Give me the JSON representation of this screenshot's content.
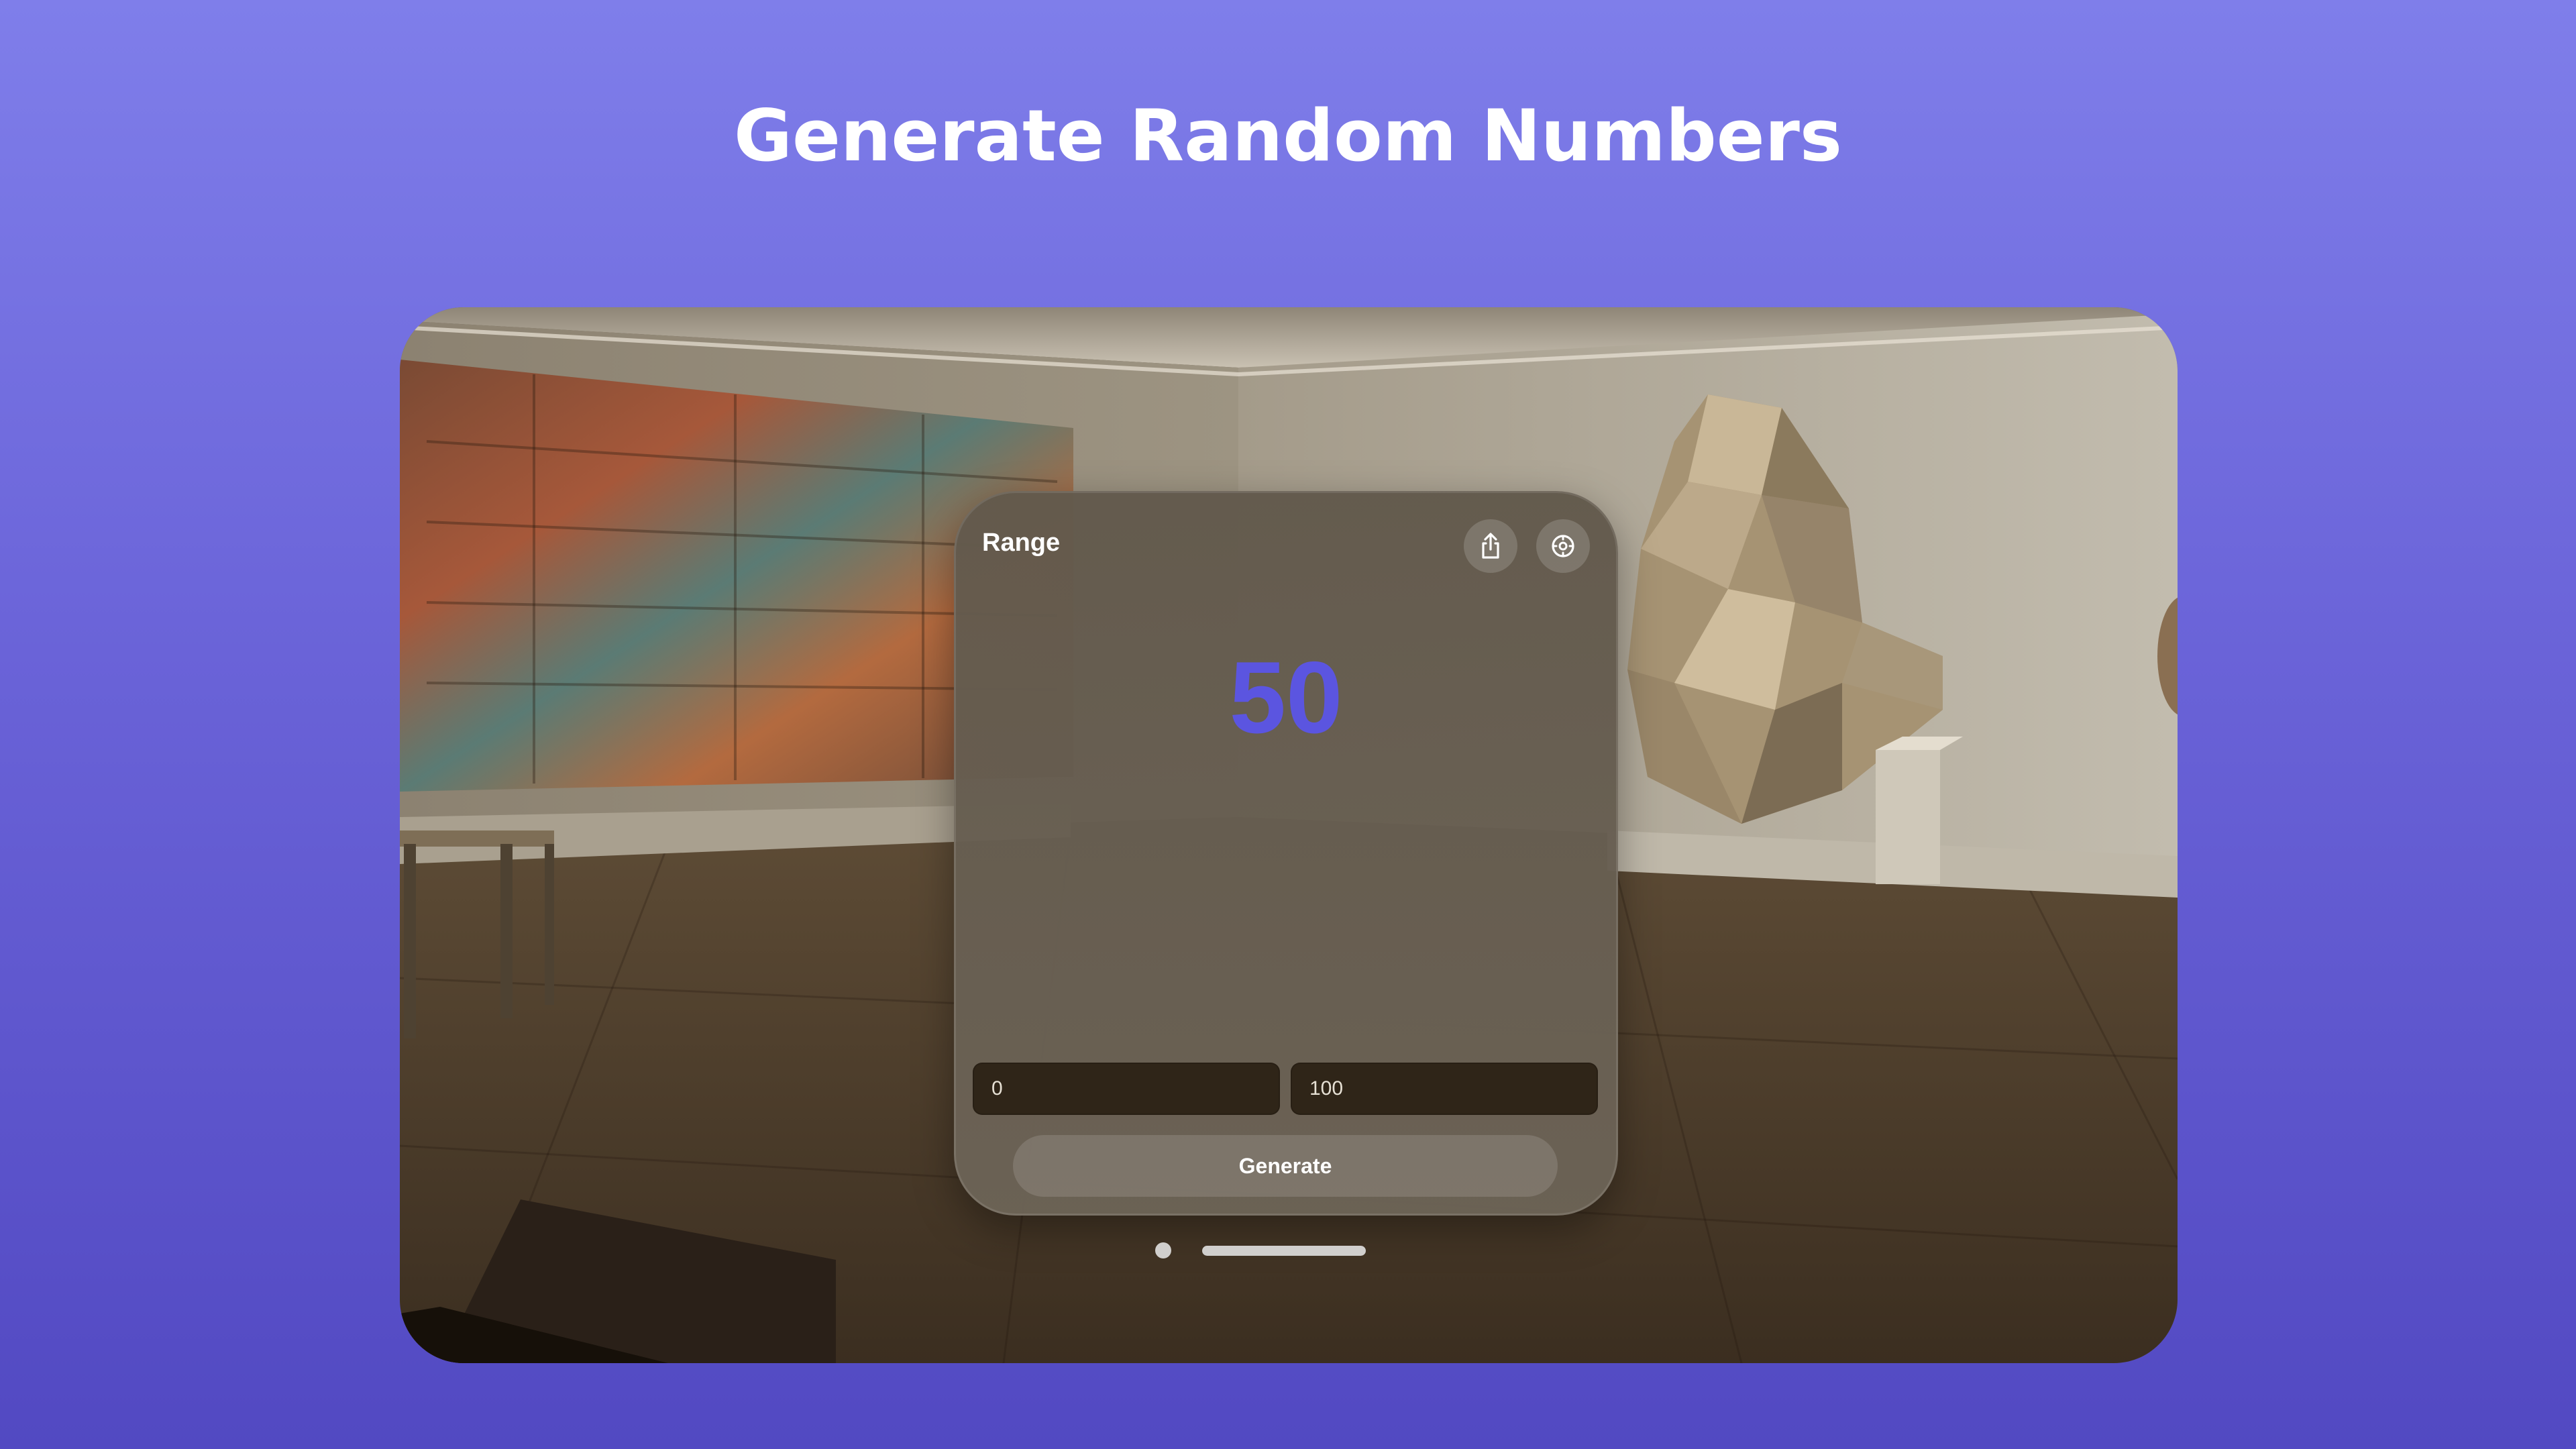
{
  "headline": "Generate Random Numbers",
  "window": {
    "title": "Range",
    "result": "50",
    "min_value": "0",
    "max_value": "100",
    "generate_label": "Generate",
    "share_icon": "share-icon",
    "settings_icon": "settings-icon"
  },
  "colors": {
    "background_top": "#7f7eea",
    "background_bottom": "#5249c2",
    "accent": "#5b55e0"
  }
}
